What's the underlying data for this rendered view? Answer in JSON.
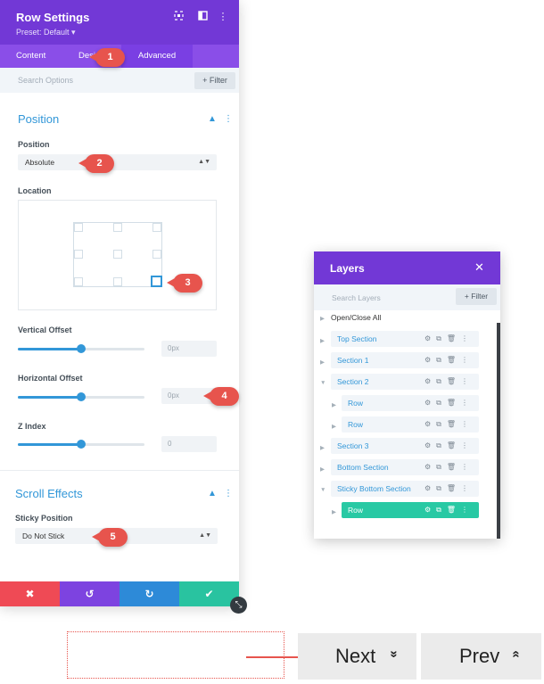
{
  "settings_panel": {
    "title": "Row Settings",
    "preset": "Preset: Default ▾",
    "header_icons": [
      "expand-icon",
      "split-view-icon",
      "more-icon"
    ],
    "tabs": [
      {
        "label": "Content"
      },
      {
        "label": "Desi"
      },
      {
        "label": "Advanced",
        "active": true
      }
    ],
    "search_placeholder": "Search Options",
    "filter_label": "+ Filter",
    "position_section": {
      "title": "Position",
      "position_label": "Position",
      "position_value": "Absolute",
      "location_label": "Location",
      "selected_location": "bottom-right",
      "vertical_offset_label": "Vertical Offset",
      "vertical_offset_value": "0px",
      "vertical_offset_slider": 0.5,
      "horizontal_offset_label": "Horizontal Offset",
      "horizontal_offset_value": "0px",
      "horizontal_offset_slider": 0.5,
      "z_index_label": "Z Index",
      "z_index_value": "0",
      "z_index_slider": 0.5
    },
    "scroll_section": {
      "title": "Scroll Effects",
      "sticky_label": "Sticky Position",
      "sticky_value": "Do Not Stick"
    },
    "bottom_buttons": [
      {
        "name": "cancel",
        "icon": "✖",
        "color": "#ef4a55"
      },
      {
        "name": "undo",
        "icon": "↺",
        "color": "#7d43e0"
      },
      {
        "name": "redo",
        "icon": "↻",
        "color": "#2d8ad8"
      },
      {
        "name": "save",
        "icon": "✔",
        "color": "#29c3a0"
      }
    ]
  },
  "markers": [
    "1",
    "2",
    "3",
    "4",
    "5"
  ],
  "layers_panel": {
    "title": "Layers",
    "close": "✕",
    "search_placeholder": "Search Layers",
    "filter_label": "+ Filter",
    "open_close_all": "Open/Close All",
    "items": [
      {
        "label": "Top Section",
        "level": 0
      },
      {
        "label": "Section 1",
        "level": 0
      },
      {
        "label": "Section 2",
        "level": 0,
        "expanded": true
      },
      {
        "label": "Row",
        "level": 1
      },
      {
        "label": "Row",
        "level": 1
      },
      {
        "label": "Section 3",
        "level": 0
      },
      {
        "label": "Bottom Section",
        "level": 0
      },
      {
        "label": "Sticky Bottom Section",
        "level": 0,
        "expanded": true
      },
      {
        "label": "Row",
        "level": 1,
        "active": true
      }
    ],
    "row_icons": [
      "gear-icon",
      "duplicate-icon",
      "trash-icon",
      "more-icon"
    ]
  },
  "navigation": {
    "next_label": "Next",
    "next_icon": "»",
    "prev_label": "Prev",
    "prev_icon": "«"
  }
}
